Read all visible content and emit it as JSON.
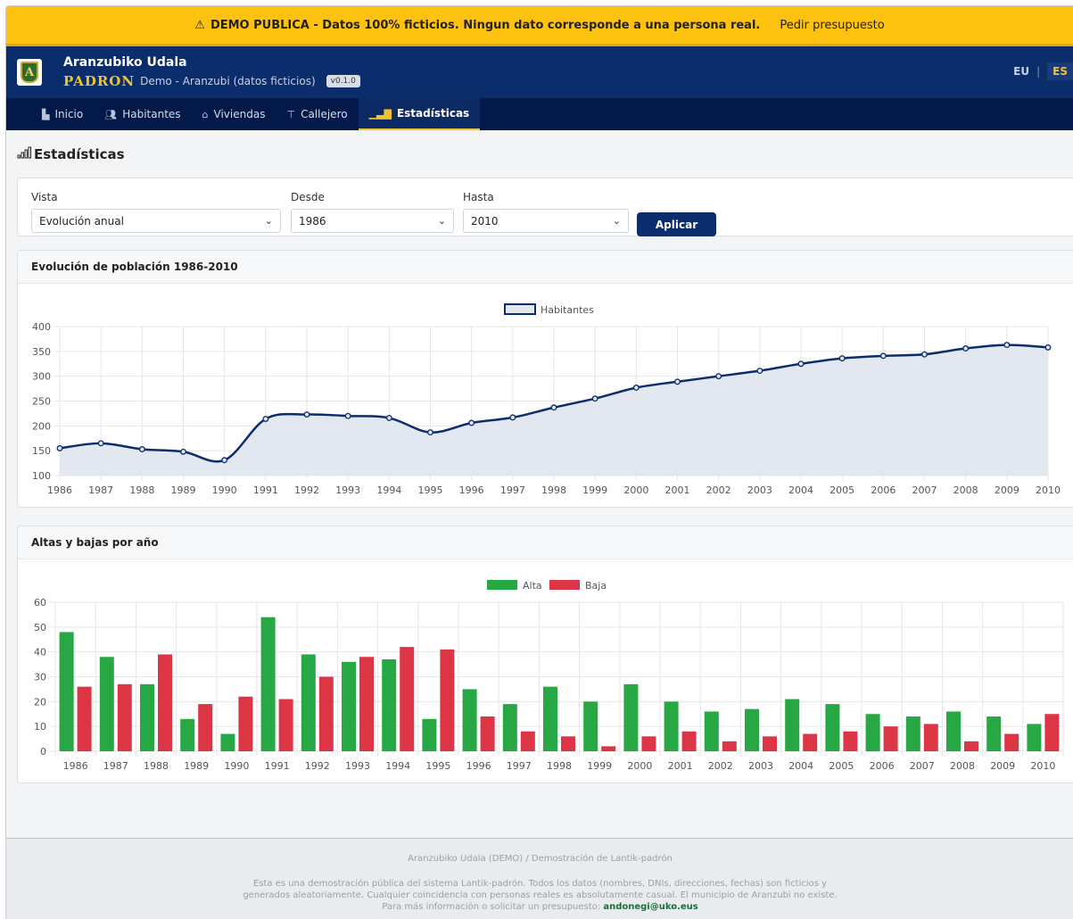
{
  "banner": {
    "icon": "warning-icon",
    "message": "DEMO PUBLICA - Datos 100% ficticios. Ningun dato corresponde a una persona real.",
    "link": "Pedir presupuesto"
  },
  "header": {
    "logo_letter": "A",
    "org_name": "Aranzubiko Udala",
    "app_name": "PADRON",
    "app_desc": "Demo - Aranzubi (datos ficticios)",
    "version": "v0.1.0",
    "lang": {
      "eu": "EU",
      "sep": "|",
      "es": "ES"
    }
  },
  "nav": [
    {
      "label": "Inicio",
      "icon": "home-grid-icon",
      "active": false
    },
    {
      "label": "Habitantes",
      "icon": "people-icon",
      "active": false
    },
    {
      "label": "Viviendas",
      "icon": "house-icon",
      "active": false
    },
    {
      "label": "Callejero",
      "icon": "signpost-icon",
      "active": false
    },
    {
      "label": "Estadísticas",
      "icon": "bar-chart-icon",
      "active": true
    }
  ],
  "page_title": "Estadísticas",
  "filters": {
    "vista_label": "Vista",
    "vista_value": "Evolución anual",
    "desde_label": "Desde",
    "desde_value": "1986",
    "hasta_label": "Hasta",
    "hasta_value": "2010",
    "apply": "Aplicar"
  },
  "charts": {
    "population_title": "Evolución de población 1986-2010",
    "altas_title": "Altas y bajas por año"
  },
  "chart_data": [
    {
      "type": "area",
      "title": "Evolución de población 1986-2010",
      "categories": [
        "1986",
        "1987",
        "1988",
        "1989",
        "1990",
        "1991",
        "1992",
        "1993",
        "1994",
        "1995",
        "1996",
        "1997",
        "1998",
        "1999",
        "2000",
        "2001",
        "2002",
        "2003",
        "2004",
        "2005",
        "2006",
        "2007",
        "2008",
        "2009",
        "2010"
      ],
      "series": [
        {
          "name": "Habitantes",
          "values": [
            155,
            165,
            153,
            148,
            131,
            214,
            223,
            220,
            216,
            187,
            206,
            217,
            237,
            255,
            277,
            289,
            300,
            311,
            325,
            336,
            341,
            344,
            356,
            363,
            358
          ]
        }
      ],
      "ylim": [
        100,
        400
      ],
      "yticks": [
        100,
        150,
        200,
        250,
        300,
        350,
        400
      ],
      "grid": true,
      "legend": "top-center",
      "colors": {
        "line": "#0b2d6b",
        "fill": "#e3e7f0"
      }
    },
    {
      "type": "bar",
      "title": "Altas y bajas por año",
      "categories": [
        "1986",
        "1987",
        "1988",
        "1989",
        "1990",
        "1991",
        "1992",
        "1993",
        "1994",
        "1995",
        "1996",
        "1997",
        "1998",
        "1999",
        "2000",
        "2001",
        "2002",
        "2003",
        "2004",
        "2005",
        "2006",
        "2007",
        "2008",
        "2009",
        "2010"
      ],
      "series": [
        {
          "name": "Alta",
          "color": "#28a745",
          "values": [
            48,
            38,
            27,
            13,
            7,
            54,
            39,
            36,
            37,
            13,
            25,
            19,
            26,
            20,
            27,
            20,
            16,
            17,
            21,
            19,
            15,
            14,
            16,
            14,
            11
          ]
        },
        {
          "name": "Baja",
          "color": "#dc3545",
          "values": [
            26,
            27,
            39,
            19,
            22,
            21,
            30,
            38,
            42,
            41,
            14,
            8,
            6,
            2,
            6,
            8,
            4,
            6,
            7,
            8,
            10,
            11,
            4,
            7,
            15
          ]
        }
      ],
      "ylim": [
        0,
        60
      ],
      "yticks": [
        0,
        10,
        20,
        30,
        40,
        50,
        60
      ],
      "grid": true,
      "legend": "top-center"
    }
  ],
  "footer": {
    "line1": "Aranzubiko Udala (DEMO) / Demostración de Lantik-padrón",
    "line2": "Esta es una demostración pública del sistema Lantik-padrón. Todos los datos (nombres, DNIs, direcciones, fechas) son ficticios y",
    "line3": "generados aleatoriamente. Cualquier coincidencia con personas reales es absolutamente casual. El municipio de Aranzubi no existe.",
    "line4": "Para más información o solicitar un presupuesto:",
    "email": "andonegi@uko.eus"
  }
}
